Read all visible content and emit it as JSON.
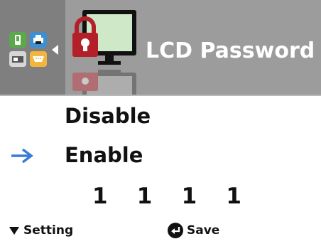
{
  "header": {
    "title": "LCD Password",
    "icon": "lcd-lock-monitor-icon",
    "category_icons": [
      "phone-icon",
      "printer-icon",
      "device-icon",
      "serial-port-icon"
    ],
    "back_icon": "left-triangle-icon"
  },
  "menu": {
    "options": [
      "Disable",
      "Enable"
    ],
    "selected_index": 1,
    "selector_icon": "right-arrow-icon"
  },
  "password": {
    "digits": [
      "1",
      "1",
      "1",
      "1"
    ]
  },
  "footer": {
    "setting_label": "Setting",
    "setting_icon": "down-triangle-icon",
    "save_label": "Save",
    "save_icon": "enter-icon"
  },
  "colors": {
    "header_bg": "#9c9c9c",
    "header_left_bg": "#7f7f7f",
    "selector_arrow": "#3a7bd5",
    "lock_red": "#b3202a",
    "screen_green": "#cfe8c8"
  }
}
